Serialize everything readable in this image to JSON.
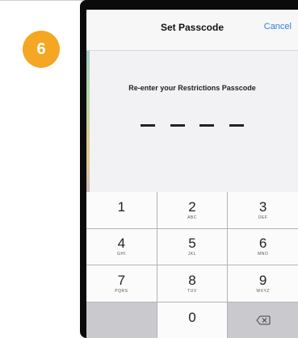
{
  "step": {
    "number": "6",
    "color": "#f5a623"
  },
  "navbar": {
    "title": "Set Passcode",
    "cancel_label": "Cancel",
    "accent": "#2f7fe0"
  },
  "prompt": "Re-enter your Restrictions Passcode",
  "passcode": {
    "digits_total": 4,
    "digits_entered": 0
  },
  "keypad": {
    "keys": [
      {
        "digit": "1",
        "letters": ""
      },
      {
        "digit": "2",
        "letters": "ABC"
      },
      {
        "digit": "3",
        "letters": "DEF"
      },
      {
        "digit": "4",
        "letters": "GHI"
      },
      {
        "digit": "5",
        "letters": "JKL"
      },
      {
        "digit": "6",
        "letters": "MNO"
      },
      {
        "digit": "7",
        "letters": "PQRS"
      },
      {
        "digit": "8",
        "letters": "TUV"
      },
      {
        "digit": "9",
        "letters": "WXYZ"
      },
      {
        "digit": "0",
        "letters": ""
      }
    ],
    "delete_icon": "backspace-icon"
  }
}
